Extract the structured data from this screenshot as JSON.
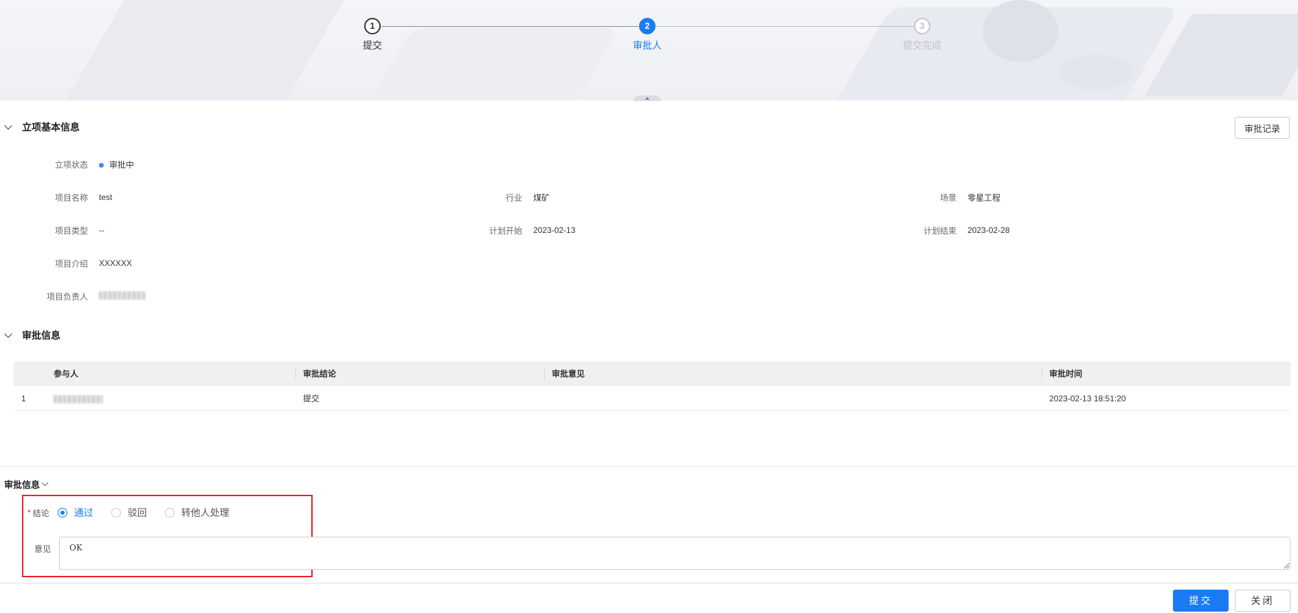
{
  "steps": [
    {
      "number": "1",
      "label": "提交"
    },
    {
      "number": "2",
      "label": "审批人"
    },
    {
      "number": "3",
      "label": "提交完成"
    }
  ],
  "basic_info": {
    "title": "立项基本信息",
    "record_button": "审批记录",
    "fields": {
      "status_label": "立项状态",
      "status_value": "审批中",
      "name_label": "项目名称",
      "name_value": "test",
      "industry_label": "行业",
      "industry_value": "煤矿",
      "scene_label": "场景",
      "scene_value": "零星工程",
      "type_label": "项目类型",
      "type_value": "--",
      "plan_start_label": "计划开始",
      "plan_start_value": "2023-02-13",
      "plan_end_label": "计划结束",
      "plan_end_value": "2023-02-28",
      "intro_label": "项目介绍",
      "intro_value": "XXXXXX",
      "owner_label": "项目负责人"
    },
    "colors": {
      "status_dot": "#3d8bf2"
    }
  },
  "approval_info": {
    "title": "审批信息",
    "table": {
      "headers": [
        "参与人",
        "审批结论",
        "审批意见",
        "审批时间"
      ],
      "rows": [
        {
          "index": "1",
          "conclusion": "提交",
          "opinion": "",
          "time": "2023-02-13 18:51:20"
        }
      ]
    }
  },
  "approval_form": {
    "title": "审批信息",
    "conclusion_label": "结论",
    "required_mark": "*",
    "options": [
      "通过",
      "驳回",
      "转他人处理"
    ],
    "selected": "通过",
    "opinion_label": "意见",
    "opinion_value": "OK"
  },
  "footer": {
    "submit": "提交",
    "close": "关闭"
  },
  "colors": {
    "accent": "#1a7bf2",
    "highlight_border": "#e8202a"
  }
}
